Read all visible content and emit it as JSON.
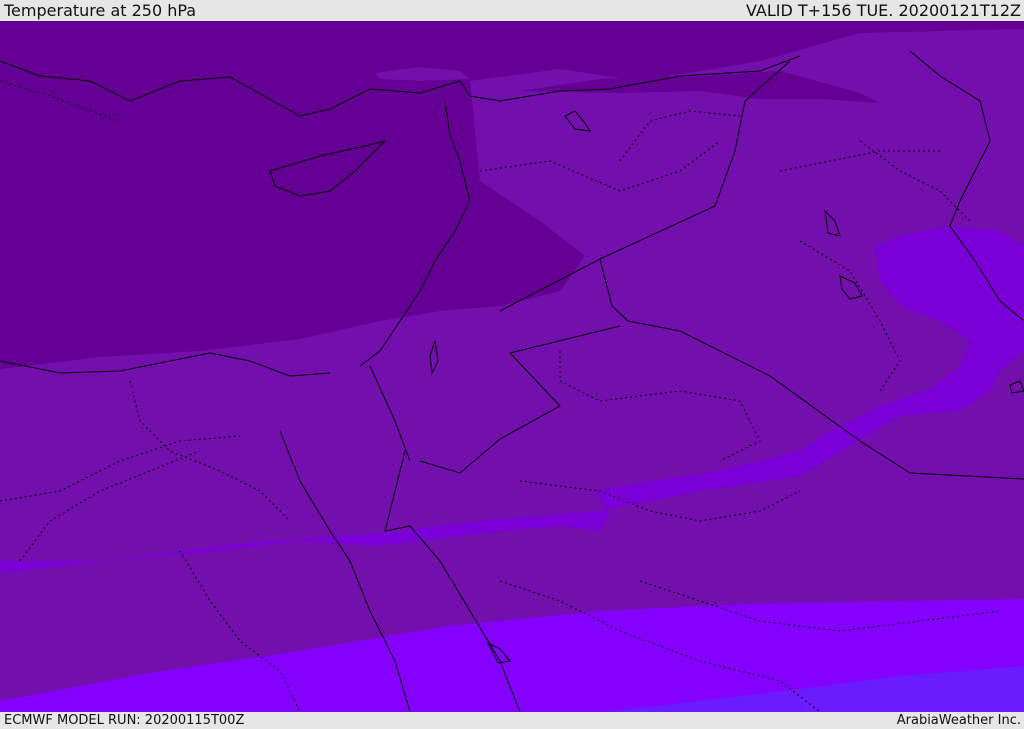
{
  "header": {
    "title": "Temperature at 250 hPa",
    "valid": "VALID T+156 TUE. 20200121T12Z"
  },
  "footer": {
    "model_run": "ECMWF MODEL RUN: 20200115T00Z",
    "credit": "ArabiaWeather Inc."
  },
  "map": {
    "colors": {
      "band_coldest": "#650094",
      "band_cold": "#7310ad",
      "band_mid": "#7b00d8",
      "band_warm": "#8400ff",
      "band_warmest": "#6a1cff",
      "outline": "#000000"
    }
  }
}
